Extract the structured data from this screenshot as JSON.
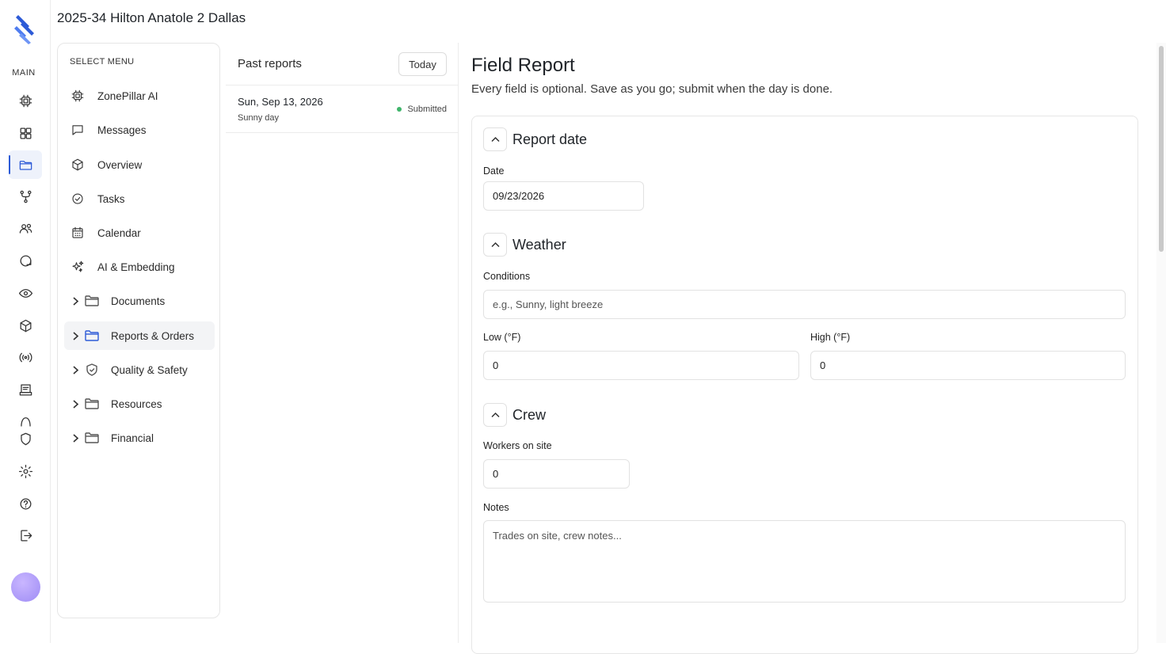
{
  "project": {
    "title": "2025-34 Hilton Anatole 2 Dallas"
  },
  "rail": {
    "main_label": "MAIN",
    "items": [
      {
        "icon": "chip-icon"
      },
      {
        "icon": "grid-icon"
      },
      {
        "icon": "folder-icon",
        "active": true
      },
      {
        "icon": "branch-icon"
      },
      {
        "icon": "users-icon"
      },
      {
        "icon": "chat-icon"
      },
      {
        "icon": "eye-icon"
      },
      {
        "icon": "cube-icon"
      },
      {
        "icon": "broadcast-icon"
      },
      {
        "icon": "document-icon"
      },
      {
        "icon": "arch-icon"
      },
      {
        "icon": "shield-icon"
      },
      {
        "icon": "gear-icon"
      },
      {
        "icon": "help-icon"
      },
      {
        "icon": "logout-icon"
      }
    ]
  },
  "menu": {
    "caption": "SELECT MENU",
    "items": [
      {
        "label": "ZonePillar AI",
        "icon": "chip-icon"
      },
      {
        "label": "Messages",
        "icon": "message-icon"
      },
      {
        "label": "Overview",
        "icon": "cube-icon"
      },
      {
        "label": "Tasks",
        "icon": "check-circle-icon"
      },
      {
        "label": "Calendar",
        "icon": "calendar-icon"
      },
      {
        "label": "AI & Embedding",
        "icon": "sparkles-icon"
      },
      {
        "label": "Documents",
        "icon": "folder-icon"
      },
      {
        "label": "Reports & Orders",
        "icon": "folder-icon",
        "active": true
      },
      {
        "label": "Quality & Safety",
        "icon": "shield-check-icon"
      },
      {
        "label": "Resources",
        "icon": "folder-icon"
      },
      {
        "label": "Financial",
        "icon": "folder-icon"
      }
    ]
  },
  "past_reports": {
    "title": "Past reports",
    "today_label": "Today",
    "items": [
      {
        "date": "Sun, Sep 13, 2026",
        "summary": "Sunny day",
        "status": "Submitted",
        "status_color": "#3fb56b"
      }
    ]
  },
  "form": {
    "title": "Field Report",
    "subtitle": "Every field is optional. Save as you go; submit when the day is done.",
    "sections": {
      "report_date": {
        "title": "Report date",
        "date_label": "Date",
        "date_value": "09/23/2026"
      },
      "weather": {
        "title": "Weather",
        "conditions_label": "Conditions",
        "conditions_placeholder": "e.g., Sunny, light breeze",
        "low_label": "Low (°F)",
        "low_value": "0",
        "high_label": "High (°F)",
        "high_value": "0"
      },
      "crew": {
        "title": "Crew",
        "workers_label": "Workers on site",
        "workers_value": "0",
        "notes_label": "Notes",
        "notes_placeholder": "Trades on site, crew notes..."
      }
    }
  },
  "colors": {
    "accent": "#2d5bd7",
    "status_submitted": "#3fb56b"
  }
}
